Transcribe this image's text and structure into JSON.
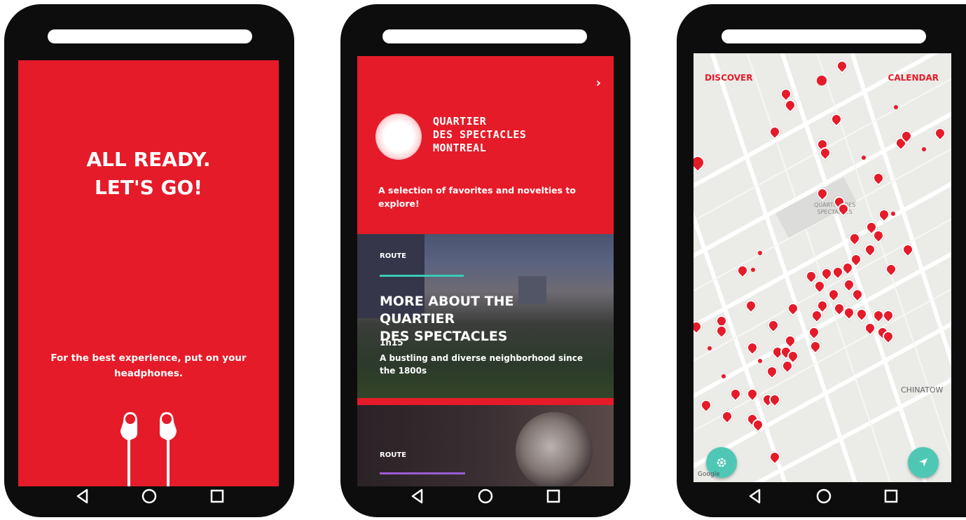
{
  "phone1": {
    "title_line1": "ALL READY.",
    "title_line2": "LET'S GO!",
    "subtitle": "For the best experience, put on your headphones.",
    "illustration_icon": "headphones-icon"
  },
  "phone2": {
    "logo_line1": "QUARTIER",
    "logo_line2": "DES SPECTACLES",
    "logo_line3": "MONTREAL",
    "description": "A selection of favorites and novelties to explore!",
    "next_icon": "chevron-right-icon",
    "card1": {
      "tag": "ROUTE",
      "title_line1": "MORE ABOUT THE QUARTIER",
      "title_line2": "DES SPECTACLES",
      "duration": "1h15",
      "description": "A bustling and diverse neighborhood since the 1800s",
      "progress_color": "#3cc9b5"
    },
    "card2": {
      "tag": "ROUTE",
      "progress_color": "#9b5bd6"
    }
  },
  "phone3": {
    "tab_discover": "DISCOVER",
    "tab_calendar": "CALENDAR",
    "district_label_line1": "QUARTIER DES",
    "district_label_line2": "SPECTACLES",
    "area_label": "CHINATOW",
    "attribution": "Google",
    "settings_icon": "gear-icon",
    "locate_icon": "navigation-arrow-icon"
  },
  "nav": {
    "back_icon": "back-triangle-icon",
    "home_icon": "home-circle-icon",
    "recents_icon": "recents-square-icon"
  },
  "colors": {
    "brand_red": "#e51b29",
    "teal": "#4fc7b5",
    "phone_body": "#0d0d0d"
  }
}
